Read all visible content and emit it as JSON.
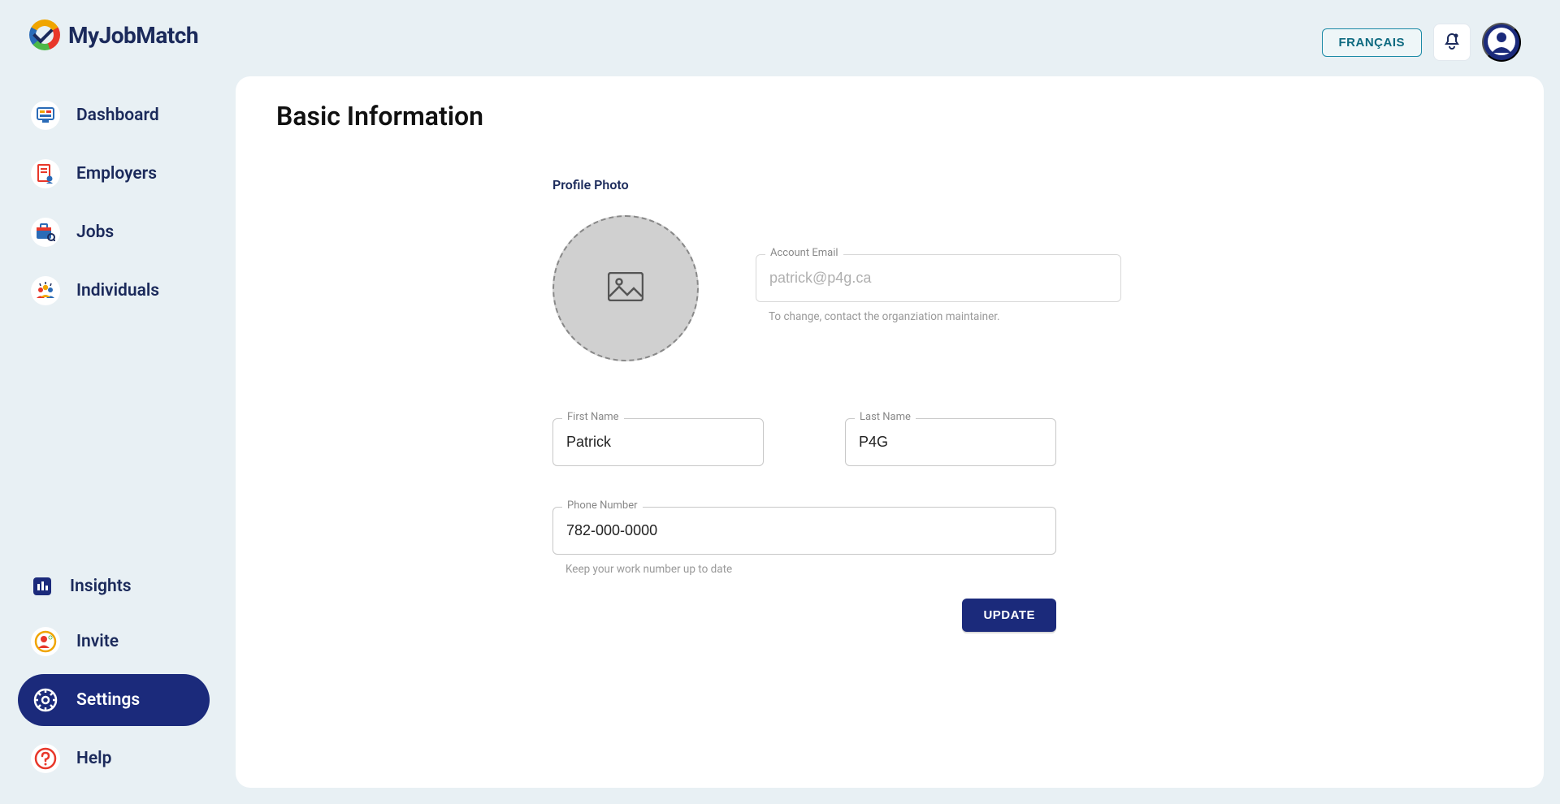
{
  "brand": {
    "text": "MyJobMatch"
  },
  "sidebar": {
    "items": [
      {
        "label": "Dashboard"
      },
      {
        "label": "Employers"
      },
      {
        "label": "Jobs"
      },
      {
        "label": "Individuals"
      }
    ],
    "secondary": [
      {
        "label": "Insights"
      },
      {
        "label": "Invite"
      },
      {
        "label": "Settings"
      },
      {
        "label": "Help"
      }
    ]
  },
  "topbar": {
    "lang_label": "FRANÇAIS"
  },
  "page": {
    "title": "Basic Information",
    "photo_label": "Profile Photo"
  },
  "form": {
    "email_label": "Account Email",
    "email_value": "patrick@p4g.ca",
    "email_helper": "To change, contact the organziation maintainer.",
    "first_label": "First Name",
    "first_value": "Patrick",
    "last_label": "Last Name",
    "last_value": "P4G",
    "phone_label": "Phone Number",
    "phone_value": "782-000-0000",
    "phone_helper": "Keep your work number up to date",
    "update_label": "UPDATE"
  }
}
